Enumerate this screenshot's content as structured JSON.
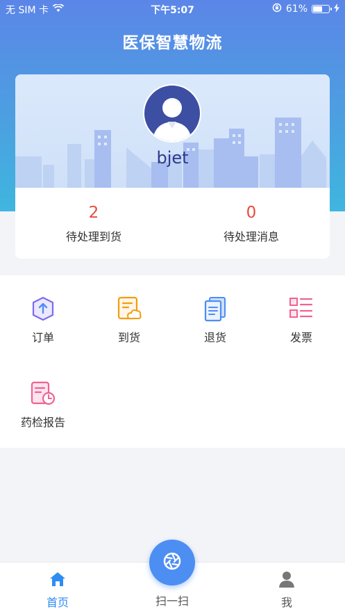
{
  "status_bar": {
    "carrier": "无 SIM 卡",
    "time": "下午5:07",
    "battery_percent": "61%",
    "battery_level": 0.61
  },
  "header": {
    "title": "医保智慧物流"
  },
  "profile": {
    "username": "bjet",
    "stats": [
      {
        "value": "2",
        "label": "待处理到货"
      },
      {
        "value": "0",
        "label": "待处理消息"
      }
    ]
  },
  "menu": {
    "items": [
      {
        "label": "订单",
        "icon": "order-icon",
        "color": "#7b6cf0"
      },
      {
        "label": "到货",
        "icon": "arrival-icon",
        "color": "#f39c12"
      },
      {
        "label": "退货",
        "icon": "return-icon",
        "color": "#4d8ef3"
      },
      {
        "label": "发票",
        "icon": "invoice-icon",
        "color": "#f06292"
      },
      {
        "label": "药检报告",
        "icon": "drug-report-icon",
        "color": "#f06292"
      }
    ]
  },
  "tabbar": {
    "home": {
      "label": "首页",
      "color": "#2f8cf0"
    },
    "scan": {
      "label": "扫一扫"
    },
    "me": {
      "label": "我",
      "color": "#555555"
    }
  }
}
